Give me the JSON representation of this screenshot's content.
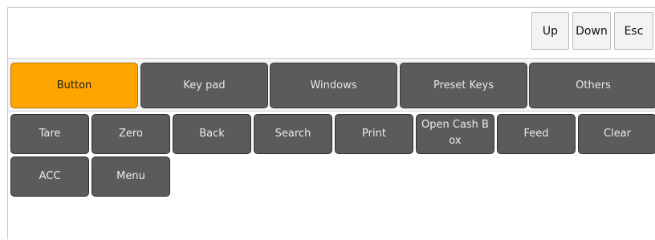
{
  "nav": {
    "up_label": "Up",
    "down_label": "Down",
    "esc_label": "Esc"
  },
  "tabs": [
    {
      "label": "Button",
      "active": true
    },
    {
      "label": "Key pad",
      "active": false
    },
    {
      "label": "Windows",
      "active": false
    },
    {
      "label": "Preset Keys",
      "active": false
    },
    {
      "label": "Others",
      "active": false
    }
  ],
  "keys": [
    {
      "label": "Tare"
    },
    {
      "label": "Zero"
    },
    {
      "label": "Back"
    },
    {
      "label": "Search"
    },
    {
      "label": "Print"
    },
    {
      "label": "Open Cash Box"
    },
    {
      "label": "Feed"
    },
    {
      "label": "Clear"
    },
    {
      "label": "ACC"
    },
    {
      "label": "Menu"
    }
  ],
  "colors": {
    "active_tab": "#ffa500",
    "key_bg": "#5b5b5b"
  }
}
